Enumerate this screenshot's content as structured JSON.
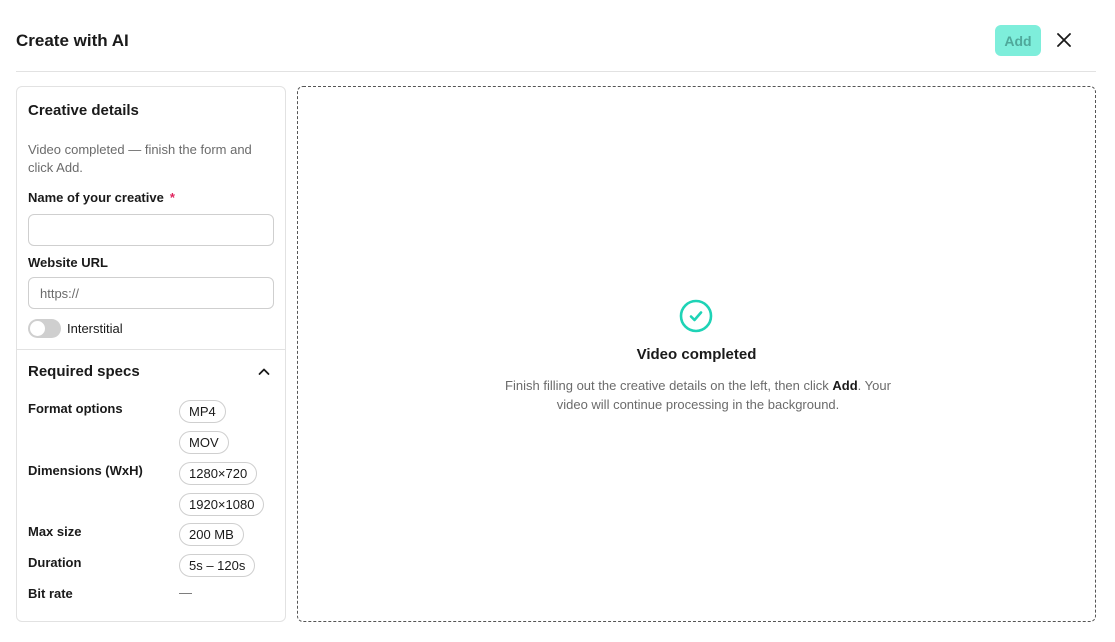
{
  "header": {
    "title": "Create with AI",
    "add_label": "Add"
  },
  "creative_details": {
    "title": "Creative details",
    "help_text": "Video completed — finish the form and click Add.",
    "name_label": "Name of your creative",
    "required_mark": "*",
    "name_value": "",
    "url_label": "Website URL",
    "url_placeholder": "https://",
    "url_value": "",
    "interstitial_label": "Interstitial",
    "interstitial_on": false
  },
  "required_specs": {
    "title": "Required specs",
    "format_label": "Format options",
    "formats": [
      "MP4",
      "MOV"
    ],
    "dimensions_label": "Dimensions (WxH)",
    "dimensions": [
      "1280×720",
      "1920×1080"
    ],
    "max_size_label": "Max size",
    "max_size": "200 MB",
    "duration_label": "Duration",
    "duration": "5s – 120s",
    "bitrate_label": "Bit rate",
    "bitrate": "—"
  },
  "status": {
    "title": "Video completed",
    "message_before": "Finish filling out the creative details on the left, then click ",
    "message_emphasis": "Add",
    "message_after": ". Your video will continue processing in the background."
  },
  "colors": {
    "accent": "#1ed3b6",
    "add_button_bg": "#7eeedb",
    "required": "#e0245e"
  }
}
